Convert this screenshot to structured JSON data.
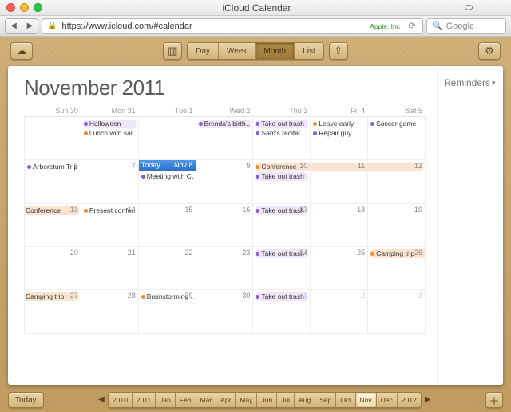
{
  "window": {
    "title": "iCloud Calendar"
  },
  "browser": {
    "url": "https://www.icloud.com/#calendar",
    "ev_label": "Apple, Inc",
    "search_placeholder": "Google"
  },
  "toolbar": {
    "views": [
      "Day",
      "Week",
      "Month",
      "List"
    ],
    "active_view": 2
  },
  "calendar": {
    "title": "November 2011",
    "today_label": "Today",
    "weekdays": [
      "Sun 30",
      "Mon 31",
      "Tue 1",
      "Wed 2",
      "Thu 3",
      "Fri 4",
      "Sat 5"
    ],
    "weekday_short": [
      "Sun",
      "Mon",
      "Tue",
      "Wed",
      "Thu",
      "Fri",
      "Sat"
    ],
    "sidebar": {
      "reminders": "Reminders"
    }
  },
  "colors": {
    "purple": "#8e5bd6",
    "orange": "#f08a24",
    "orange_bg": "#fbe4cf",
    "purple_bg": "#f0e6fa"
  },
  "days": [
    {
      "n": "30",
      "dim": true,
      "events": []
    },
    {
      "n": "31",
      "dim": true,
      "events": [
        {
          "t": "Halloween",
          "c": "purple",
          "bg": "purple_bg"
        },
        {
          "t": "Lunch with sal…",
          "c": "orange"
        }
      ]
    },
    {
      "n": "1",
      "events": []
    },
    {
      "n": "2",
      "events": [
        {
          "t": "Brenda's birth…",
          "c": "purple",
          "bg": "purple_bg"
        }
      ]
    },
    {
      "n": "3",
      "events": [
        {
          "t": "Take out trash",
          "c": "purple",
          "bg": "purple_bg"
        },
        {
          "t": "Sam's recital",
          "c": "purple"
        }
      ]
    },
    {
      "n": "4",
      "events": [
        {
          "t": "Leave early",
          "c": "orange"
        },
        {
          "t": "Repair guy",
          "c": "purple"
        }
      ]
    },
    {
      "n": "5",
      "events": [
        {
          "t": "Soccer game",
          "c": "purple"
        }
      ]
    },
    {
      "n": "6",
      "events": [
        {
          "t": "Arboretum Trip",
          "c": "purple"
        }
      ]
    },
    {
      "n": "7",
      "events": []
    },
    {
      "n": "8",
      "today": true,
      "today_date": "Nov 8",
      "events": [
        {
          "t": "Meeting with C…",
          "c": "purple"
        }
      ]
    },
    {
      "n": "9",
      "events": []
    },
    {
      "n": "10",
      "events": [
        {
          "t": "Conference",
          "c": "orange",
          "bg": "orange_bg",
          "span": "start"
        },
        {
          "t": "Take out trash",
          "c": "purple",
          "bg": "purple_bg"
        }
      ]
    },
    {
      "n": "11",
      "events": [
        {
          "t": " ",
          "c": "orange",
          "bg": "orange_bg",
          "span": "mid"
        }
      ]
    },
    {
      "n": "12",
      "events": [
        {
          "t": " ",
          "c": "orange",
          "bg": "orange_bg",
          "span": "end"
        }
      ]
    },
    {
      "n": "13",
      "events": [
        {
          "t": "Conference",
          "c": "orange",
          "bg": "orange_bg",
          "span": "end"
        }
      ]
    },
    {
      "n": "14",
      "events": [
        {
          "t": "Present confer…",
          "c": "orange"
        }
      ]
    },
    {
      "n": "15",
      "events": []
    },
    {
      "n": "16",
      "events": []
    },
    {
      "n": "17",
      "events": [
        {
          "t": "Take out trash",
          "c": "purple",
          "bg": "purple_bg"
        }
      ]
    },
    {
      "n": "18",
      "events": []
    },
    {
      "n": "19",
      "events": []
    },
    {
      "n": "20",
      "events": []
    },
    {
      "n": "21",
      "events": []
    },
    {
      "n": "22",
      "events": []
    },
    {
      "n": "23",
      "events": []
    },
    {
      "n": "24",
      "events": [
        {
          "t": "Take out trash",
          "c": "purple",
          "bg": "purple_bg"
        }
      ]
    },
    {
      "n": "25",
      "events": []
    },
    {
      "n": "26",
      "events": [
        {
          "t": "Camping trip",
          "c": "orange",
          "bg": "orange_bg",
          "span": "start"
        }
      ]
    },
    {
      "n": "27",
      "events": [
        {
          "t": "Camping trip",
          "c": "orange",
          "bg": "orange_bg",
          "span": "end"
        }
      ]
    },
    {
      "n": "28",
      "events": []
    },
    {
      "n": "29",
      "events": [
        {
          "t": "Brainstorming …",
          "c": "orange"
        }
      ]
    },
    {
      "n": "30",
      "events": []
    },
    {
      "n": "1",
      "dim": true,
      "events": [
        {
          "t": "Take out trash",
          "c": "purple",
          "bg": "purple_bg"
        }
      ]
    },
    {
      "n": "2",
      "dim": true,
      "events": []
    },
    {
      "n": "3",
      "dim": true,
      "events": []
    }
  ],
  "timeline": {
    "today": "Today",
    "items": [
      "2010",
      "2011",
      "Jan",
      "Feb",
      "Mar",
      "Apr",
      "May",
      "Jun",
      "Jul",
      "Aug",
      "Sep",
      "Oct",
      "Nov",
      "Dec",
      "2012"
    ],
    "active": 12
  }
}
